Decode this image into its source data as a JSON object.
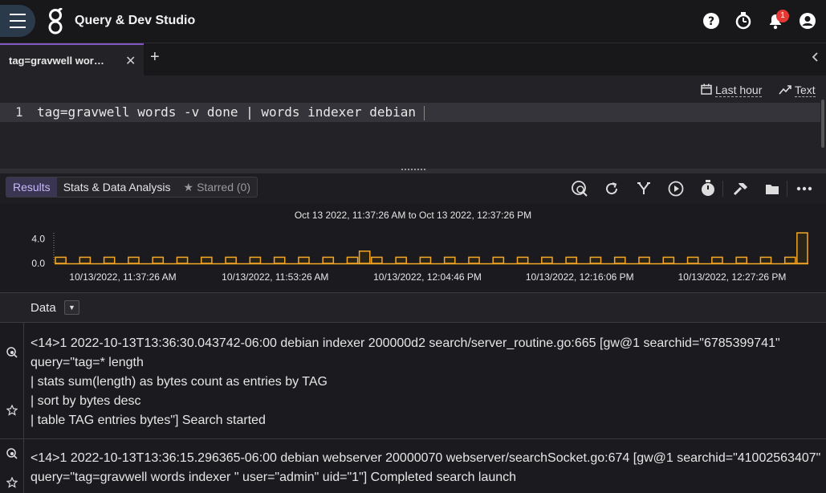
{
  "app": {
    "title": "Query & Dev Studio",
    "notification_count": "1"
  },
  "icons": {
    "menu": "menu-icon",
    "logo": "gravwell-logo",
    "help": "help-icon",
    "timer": "timer-icon",
    "notifications": "bell-icon",
    "account": "account-icon"
  },
  "tabs": [
    {
      "label": "tag=gravwell wor…"
    }
  ],
  "editor": {
    "line_number": "1",
    "query": "tag=gravwell words -v done | words indexer debian",
    "time_range_label": "Last hour",
    "renderer_label": "Text"
  },
  "results": {
    "tabs": [
      {
        "label": "Results"
      },
      {
        "label": "Stats & Data Analysis"
      },
      {
        "label": "Starred (0)"
      }
    ]
  },
  "chart_data": {
    "type": "bar",
    "title": "Oct 13 2022, 11:37:26 AM to Oct 13 2022, 12:37:26 PM",
    "ytick_labels": [
      "4.0",
      "0.0"
    ],
    "ylim": [
      0,
      5
    ],
    "xtick_labels": [
      "10/13/2022, 11:37:26 AM",
      "10/13/2022, 11:53:26 AM",
      "10/13/2022, 12:04:46 PM",
      "10/13/2022, 12:16:06 PM",
      "10/13/2022, 12:27:26 PM"
    ],
    "values": [
      1,
      0,
      1,
      0,
      1,
      0,
      1,
      0,
      1,
      0,
      1,
      0,
      1,
      0,
      1,
      0,
      1,
      0,
      1,
      0,
      1,
      0,
      1,
      0,
      1,
      2,
      1,
      0,
      1,
      0,
      1,
      0,
      1,
      0,
      1,
      0,
      1,
      0,
      1,
      0,
      1,
      0,
      1,
      0,
      1,
      0,
      1,
      0,
      1,
      0,
      1,
      0,
      1,
      0,
      1,
      0,
      1,
      0,
      1,
      0,
      1,
      5
    ],
    "bar_color": "#f5a623"
  },
  "data_panel": {
    "label": "Data"
  },
  "rows": [
    {
      "lines": [
        "<14>1 2022-10-13T13:36:30.043742-06:00 debian indexer 200000d2 search/server_routine.go:665 [gw@1 searchid=\"6785399741\"",
        "query=\"tag=* length",
        "| stats sum(length) as bytes count as entries by TAG",
        "| sort by bytes desc",
        "| table TAG entries bytes\"] Search started"
      ]
    },
    {
      "lines": [
        "<14>1 2022-10-13T13:36:15.296365-06:00 debian webserver 20000070 webserver/searchSocket.go:674 [gw@1 searchid=\"41002563407\"",
        "query=\"tag=gravwell words indexer \" user=\"admin\" uid=\"1\"] Completed search launch"
      ]
    }
  ]
}
